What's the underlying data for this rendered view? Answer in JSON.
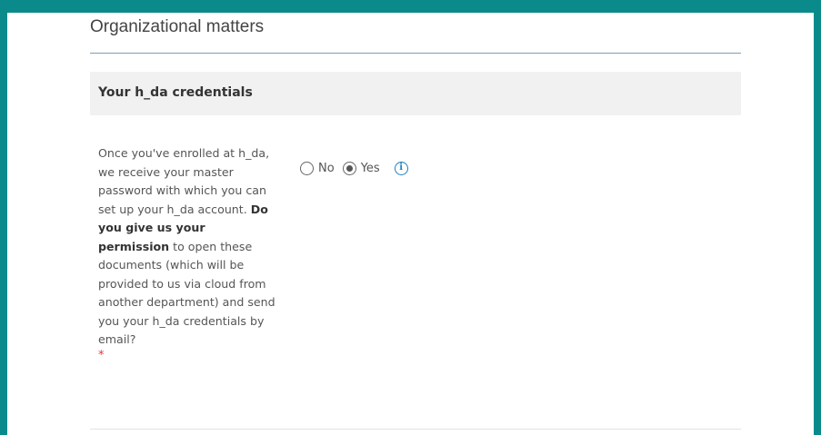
{
  "section": {
    "title": "Organizational matters"
  },
  "subsection": {
    "title": "Your h_da credentials"
  },
  "question": {
    "text_before": "Once you've enrolled at h_da, we receive your master password with which you can set up your h_da account. ",
    "text_bold": "Do you give us your permission",
    "text_after": " to open these documents (which will be provided to us via cloud from another department) and send you your h_da credentials by email?",
    "required_marker": "*"
  },
  "options": {
    "no_label": "No",
    "yes_label": "Yes",
    "selected": "Yes"
  },
  "info": {
    "icon": "info-icon",
    "glyph": "i"
  },
  "colors": {
    "background": "#0a8a8a",
    "accent": "#1e7fc0",
    "required": "#e53935"
  }
}
